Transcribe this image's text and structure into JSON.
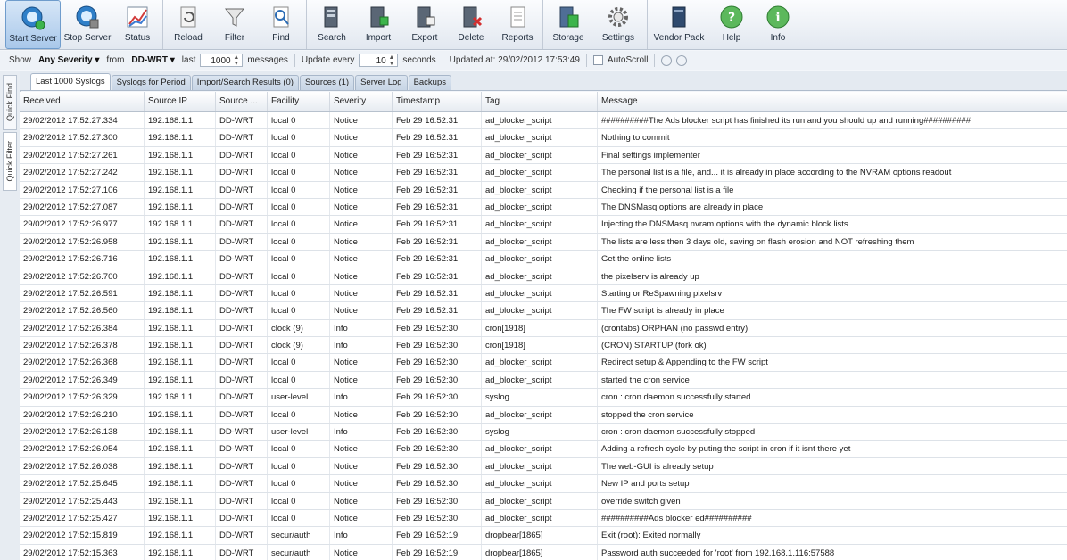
{
  "toolbar": {
    "buttons": [
      {
        "label": "Start Server",
        "icon": "start-server-icon"
      },
      {
        "label": "Stop Server",
        "icon": "stop-server-icon"
      },
      {
        "label": "Status",
        "icon": "status-chart-icon"
      },
      {
        "label": "Reload",
        "icon": "reload-icon"
      },
      {
        "label": "Filter",
        "icon": "filter-icon"
      },
      {
        "label": "Find",
        "icon": "find-icon"
      },
      {
        "label": "Search",
        "icon": "search-icon"
      },
      {
        "label": "Import",
        "icon": "import-icon"
      },
      {
        "label": "Export",
        "icon": "export-icon"
      },
      {
        "label": "Delete",
        "icon": "delete-icon"
      },
      {
        "label": "Reports",
        "icon": "reports-icon"
      },
      {
        "label": "Storage",
        "icon": "storage-icon"
      },
      {
        "label": "Settings",
        "icon": "settings-gear-icon"
      },
      {
        "label": "Vendor Pack",
        "icon": "vendor-pack-icon"
      },
      {
        "label": "Help",
        "icon": "help-icon"
      },
      {
        "label": "Info",
        "icon": "info-icon"
      }
    ]
  },
  "options": {
    "show_label": "Show",
    "severity": "Any Severity",
    "from_label": "from",
    "source": "DD-WRT",
    "last_label": "last",
    "count": "1000",
    "messages_label": "messages",
    "update_label": "Update every",
    "interval": "10",
    "seconds_label": "seconds",
    "updated_text": "Updated at: 29/02/2012 17:53:49",
    "autoscroll_label": "AutoScroll"
  },
  "side_tabs": [
    "Quick Find",
    "Quick Filter"
  ],
  "tabs": [
    "Last 1000 Syslogs",
    "Syslogs for Period",
    "Import/Search Results (0)",
    "Sources (1)",
    "Server Log",
    "Backups"
  ],
  "grid": {
    "columns": [
      "Received",
      "Source IP",
      "Source ...",
      "Facility",
      "Severity",
      "Timestamp",
      "Tag",
      "Message"
    ],
    "rows": [
      [
        "29/02/2012 17:52:27.334",
        "192.168.1.1",
        "DD-WRT",
        "local 0",
        "Notice",
        "Feb 29 16:52:31",
        "ad_blocker_script",
        "##########The Ads blocker script has finished its run and you should up and running##########"
      ],
      [
        "29/02/2012 17:52:27.300",
        "192.168.1.1",
        "DD-WRT",
        "local 0",
        "Notice",
        "Feb 29 16:52:31",
        "ad_blocker_script",
        "Nothing to commit"
      ],
      [
        "29/02/2012 17:52:27.261",
        "192.168.1.1",
        "DD-WRT",
        "local 0",
        "Notice",
        "Feb 29 16:52:31",
        "ad_blocker_script",
        "Final settings implementer"
      ],
      [
        "29/02/2012 17:52:27.242",
        "192.168.1.1",
        "DD-WRT",
        "local 0",
        "Notice",
        "Feb 29 16:52:31",
        "ad_blocker_script",
        "The personal list is a file, and... it is already in place according to the NVRAM options readout"
      ],
      [
        "29/02/2012 17:52:27.106",
        "192.168.1.1",
        "DD-WRT",
        "local 0",
        "Notice",
        "Feb 29 16:52:31",
        "ad_blocker_script",
        "Checking if the personal list is a file"
      ],
      [
        "29/02/2012 17:52:27.087",
        "192.168.1.1",
        "DD-WRT",
        "local 0",
        "Notice",
        "Feb 29 16:52:31",
        "ad_blocker_script",
        "The DNSMasq options are already in place"
      ],
      [
        "29/02/2012 17:52:26.977",
        "192.168.1.1",
        "DD-WRT",
        "local 0",
        "Notice",
        "Feb 29 16:52:31",
        "ad_blocker_script",
        "Injecting the DNSMasq nvram options with the dynamic block lists"
      ],
      [
        "29/02/2012 17:52:26.958",
        "192.168.1.1",
        "DD-WRT",
        "local 0",
        "Notice",
        "Feb 29 16:52:31",
        "ad_blocker_script",
        "The lists are less then 3 days old, saving on flash erosion and NOT refreshing them"
      ],
      [
        "29/02/2012 17:52:26.716",
        "192.168.1.1",
        "DD-WRT",
        "local 0",
        "Notice",
        "Feb 29 16:52:31",
        "ad_blocker_script",
        "Get the online lists"
      ],
      [
        "29/02/2012 17:52:26.700",
        "192.168.1.1",
        "DD-WRT",
        "local 0",
        "Notice",
        "Feb 29 16:52:31",
        "ad_blocker_script",
        "the pixelserv is already up"
      ],
      [
        "29/02/2012 17:52:26.591",
        "192.168.1.1",
        "DD-WRT",
        "local 0",
        "Notice",
        "Feb 29 16:52:31",
        "ad_blocker_script",
        "Starting or ReSpawning pixelsrv"
      ],
      [
        "29/02/2012 17:52:26.560",
        "192.168.1.1",
        "DD-WRT",
        "local 0",
        "Notice",
        "Feb 29 16:52:31",
        "ad_blocker_script",
        "The FW script is already in place"
      ],
      [
        "29/02/2012 17:52:26.384",
        "192.168.1.1",
        "DD-WRT",
        "clock (9)",
        "Info",
        "Feb 29 16:52:30",
        "cron[1918]",
        "(crontabs) ORPHAN (no passwd entry)"
      ],
      [
        "29/02/2012 17:52:26.378",
        "192.168.1.1",
        "DD-WRT",
        "clock (9)",
        "Info",
        "Feb 29 16:52:30",
        "cron[1918]",
        "(CRON) STARTUP (fork ok)"
      ],
      [
        "29/02/2012 17:52:26.368",
        "192.168.1.1",
        "DD-WRT",
        "local 0",
        "Notice",
        "Feb 29 16:52:30",
        "ad_blocker_script",
        "Redirect setup & Appending to the FW script"
      ],
      [
        "29/02/2012 17:52:26.349",
        "192.168.1.1",
        "DD-WRT",
        "local 0",
        "Notice",
        "Feb 29 16:52:30",
        "ad_blocker_script",
        "started the cron service"
      ],
      [
        "29/02/2012 17:52:26.329",
        "192.168.1.1",
        "DD-WRT",
        "user-level",
        "Info",
        "Feb 29 16:52:30",
        "syslog",
        "cron : cron daemon successfully started"
      ],
      [
        "29/02/2012 17:52:26.210",
        "192.168.1.1",
        "DD-WRT",
        "local 0",
        "Notice",
        "Feb 29 16:52:30",
        "ad_blocker_script",
        "stopped the cron service"
      ],
      [
        "29/02/2012 17:52:26.138",
        "192.168.1.1",
        "DD-WRT",
        "user-level",
        "Info",
        "Feb 29 16:52:30",
        "syslog",
        "cron : cron daemon successfully stopped"
      ],
      [
        "29/02/2012 17:52:26.054",
        "192.168.1.1",
        "DD-WRT",
        "local 0",
        "Notice",
        "Feb 29 16:52:30",
        "ad_blocker_script",
        "Adding a refresh cycle by puting the script in cron if it isnt there yet"
      ],
      [
        "29/02/2012 17:52:26.038",
        "192.168.1.1",
        "DD-WRT",
        "local 0",
        "Notice",
        "Feb 29 16:52:30",
        "ad_blocker_script",
        "The web-GUI is already setup"
      ],
      [
        "29/02/2012 17:52:25.645",
        "192.168.1.1",
        "DD-WRT",
        "local 0",
        "Notice",
        "Feb 29 16:52:30",
        "ad_blocker_script",
        "New IP and ports setup"
      ],
      [
        "29/02/2012 17:52:25.443",
        "192.168.1.1",
        "DD-WRT",
        "local 0",
        "Notice",
        "Feb 29 16:52:30",
        "ad_blocker_script",
        "override switch given"
      ],
      [
        "29/02/2012 17:52:25.427",
        "192.168.1.1",
        "DD-WRT",
        "local 0",
        "Notice",
        "Feb 29 16:52:30",
        "ad_blocker_script",
        "##########Ads blocker ed##########"
      ],
      [
        "29/02/2012 17:52:15.819",
        "192.168.1.1",
        "DD-WRT",
        "secur/auth",
        "Info",
        "Feb 29 16:52:19",
        "dropbear[1865]",
        "Exit (root): Exited normally"
      ],
      [
        "29/02/2012 17:52:15.363",
        "192.168.1.1",
        "DD-WRT",
        "secur/auth",
        "Notice",
        "Feb 29 16:52:19",
        "dropbear[1865]",
        "Password auth succeeded for 'root' from 192.168.1.116:57588"
      ]
    ]
  }
}
